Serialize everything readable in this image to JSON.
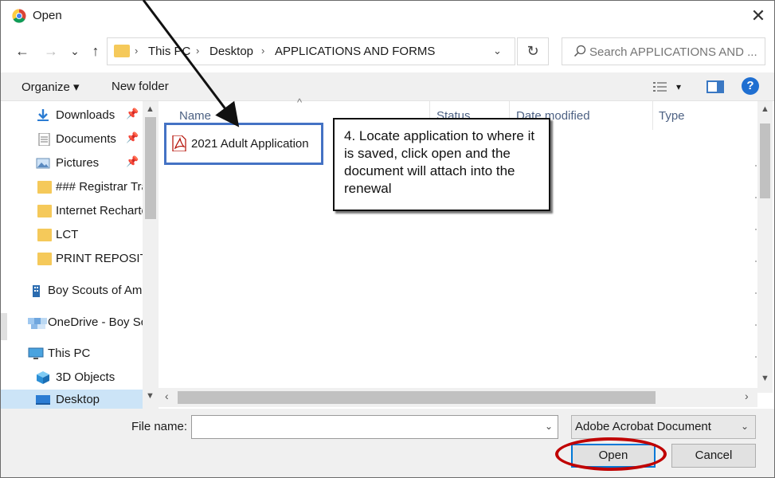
{
  "window": {
    "title": "Open",
    "close_symbol": "✕"
  },
  "nav": {
    "back": "←",
    "forward": "→",
    "recent": "⌄",
    "up": "↑",
    "breadcrumbs": [
      "This PC",
      "Desktop",
      "APPLICATIONS AND FORMS"
    ],
    "separator": "›",
    "address_dropdown": "⌄",
    "refresh": "↻",
    "search_placeholder": "Search APPLICATIONS AND ..."
  },
  "toolbar": {
    "organize": "Organize ▾",
    "new_folder": "New folder",
    "view_caret": "▾",
    "help": "?"
  },
  "sidebar": {
    "items": [
      {
        "label": "Downloads",
        "icon": "download-icon",
        "pinned": true
      },
      {
        "label": "Documents",
        "icon": "documents-icon",
        "pinned": true
      },
      {
        "label": "Pictures",
        "icon": "pictures-icon",
        "pinned": true
      },
      {
        "label": "### Registrar Tra",
        "icon": "folder-icon",
        "pinned": false
      },
      {
        "label": "Internet Recharte",
        "icon": "folder-icon",
        "pinned": false
      },
      {
        "label": "LCT",
        "icon": "folder-icon",
        "pinned": false
      },
      {
        "label": "PRINT REPOSITO",
        "icon": "folder-icon",
        "pinned": false
      },
      {
        "label": "Boy Scouts of Am",
        "icon": "building-icon",
        "pinned": false
      },
      {
        "label": "OneDrive - Boy Sc",
        "icon": "onedrive-icon",
        "pinned": false
      },
      {
        "label": "This PC",
        "icon": "computer-icon",
        "pinned": false
      },
      {
        "label": "3D Objects",
        "icon": "cube-icon",
        "pinned": false
      },
      {
        "label": "Desktop",
        "icon": "desktop-icon",
        "pinned": false
      }
    ],
    "pin_symbol": "📌"
  },
  "columns": {
    "name": "Name",
    "status": "Status",
    "date_modified": "Date modified",
    "type": "Type"
  },
  "files": [
    {
      "name": "2021 Adult Application",
      "icon": "pdf-icon"
    }
  ],
  "bottom": {
    "file_name_label": "File name:",
    "file_name_value": "",
    "file_type": "Adobe Acrobat Document",
    "open_button": "Open",
    "cancel_button": "Cancel"
  },
  "annotation": {
    "callout_text": "4. Locate application to where it is saved, click open and the document will attach into the renewal"
  },
  "colors": {
    "accent": "#0078d7",
    "highlight_box": "#4472c4",
    "red_circle": "#c00000",
    "folder": "#f5c95a"
  }
}
